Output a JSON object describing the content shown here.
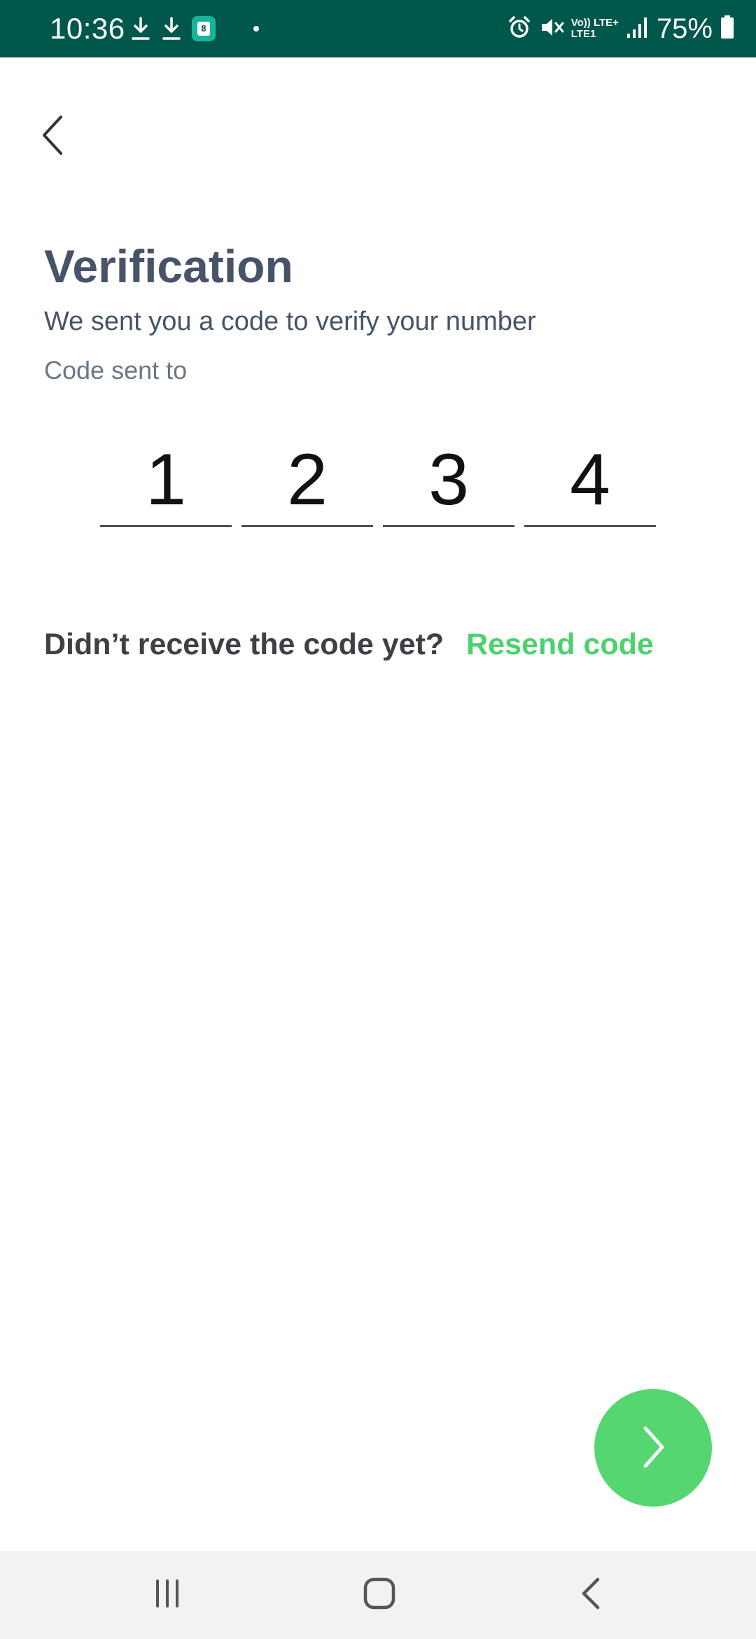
{
  "status_bar": {
    "time": "10:36",
    "left_icons": [
      "download-icon",
      "download-icon",
      "calendar-app-icon",
      "dot-icon"
    ],
    "right_icons": [
      "alarm-icon",
      "mute-icon",
      "volte-lte-icon",
      "signal-icon",
      "battery-icon"
    ],
    "volte_label": "Vo)) LTE+",
    "lte_label": "LTE1",
    "battery_percent": "75%",
    "background_color": "#00574b"
  },
  "header": {
    "back_icon": "chevron-left-icon"
  },
  "main": {
    "title": "Verification",
    "subtitle": "We sent you a code to verify your number",
    "code_sent_to": "Code sent to",
    "otp_digits": [
      "1",
      "2",
      "3",
      "4"
    ],
    "resend_question": "Didn’t receive the code yet?",
    "resend_link": "Resend code"
  },
  "fab": {
    "icon": "chevron-right-icon",
    "color": "#55d670"
  },
  "colors": {
    "title_text": "#465368",
    "accent_green": "#4cd26d"
  },
  "nav_bar": {
    "buttons": [
      "recents-icon",
      "home-icon",
      "back-icon"
    ]
  }
}
